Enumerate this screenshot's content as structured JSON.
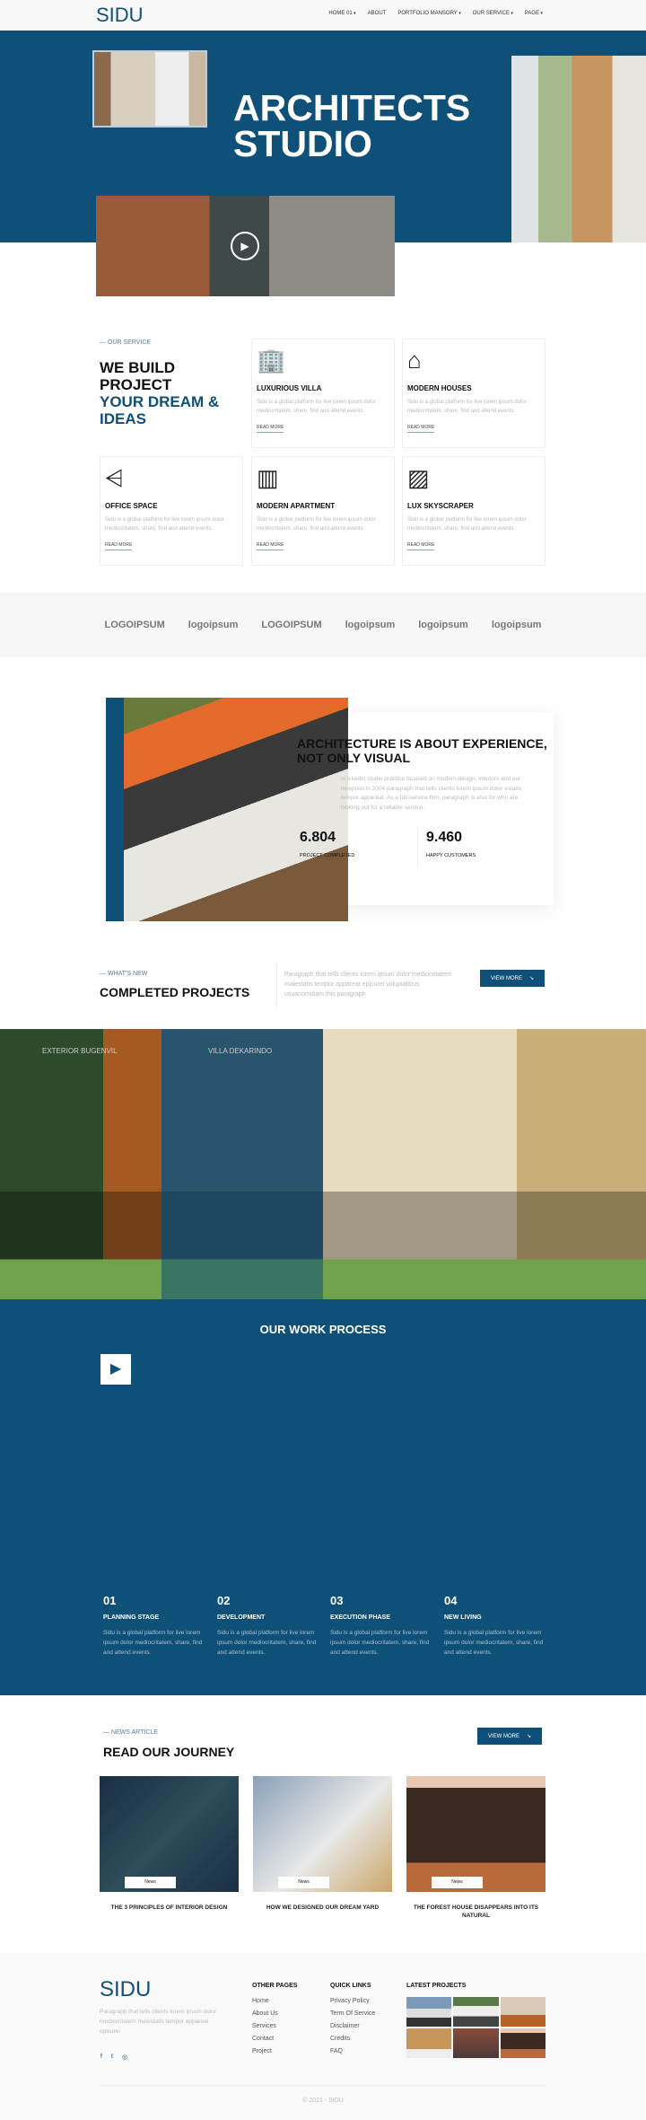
{
  "nav": {
    "logo": "SIDU",
    "items": [
      "HOME 01",
      "ABOUT",
      "PORTFOLIO MANSORY",
      "OUR SERVICE",
      "PAGE"
    ]
  },
  "hero": {
    "title_line1": "ARCHITECTS",
    "title_line2": "STUDIO",
    "brand_color": "#0f5078"
  },
  "service": {
    "label": "OUR SERVICE",
    "title_dark": "WE BUILD PROJECT",
    "title_blue": "YOUR DREAM & IDEAS",
    "cards": [
      {
        "icon": "building-icon",
        "glyph": "🏢",
        "title": "LUXURIOUS VILLA",
        "text": "Sidu is a global platform for live lorem ipsum dolor mediocritatem, share, find and attend events.",
        "link": "READ MORE"
      },
      {
        "icon": "house-icon",
        "glyph": "⌂",
        "title": "MODERN HOUSES",
        "text": "Sidu is a global platform for live lorem ipsum dolor mediocritatem, share, find and attend events.",
        "link": "READ MORE"
      },
      {
        "icon": "stairs-icon",
        "glyph": "⩤",
        "title": "OFFICE SPACE",
        "text": "Sidu is a global platform for live lorem ipsum dolor mediocritatem, share, find and attend events.",
        "link": "READ MORE"
      },
      {
        "icon": "balcony-icon",
        "glyph": "▥",
        "title": "MODERN APARTMENT",
        "text": "Sidu is a global platform for live lorem ipsum dolor mediocritatem, share, find and attend events.",
        "link": "READ MORE"
      },
      {
        "icon": "parquet-icon",
        "glyph": "▨",
        "title": "LUX SKYSCRAPER",
        "text": "Sidu is a global platform for live lorem ipsum dolor mediocritatem, share, find and attend events.",
        "link": "READ MORE"
      }
    ]
  },
  "logos": [
    "LOGOIPSUM",
    "logoipsum",
    "LOGOIPSUM",
    "logoipsum",
    "logoipsum",
    "logoipsum"
  ],
  "about": {
    "title": "ARCHITECTURE IS ABOUT EXPERIENCE, NOT ONLY VISUAL",
    "text": "is a kediri studio practice focused on modern design, interiors and our inception in 2004 paragraph that tells clients lorem ipsum dolor estatis tempor appareat. As a full-service firm, paragraph is also for who are looking out for a reliable service.",
    "stats": [
      {
        "value": "6.804",
        "label": "PROJECT COMPLETED"
      },
      {
        "value": "9.460",
        "label": "HAPPY CUSTOMERS"
      }
    ]
  },
  "projects": {
    "label": "WHAT'S NEW",
    "title": "COMPLETED PROJECTS",
    "text": "Paragraph that tells clients lorem ipsum dolor mediocritatem maiestatis tempor appareat epicurei voluptatibus usuanomittam this paragraph",
    "button": "VIEW MORE",
    "gallery": [
      "EXTERIOR BUGENVIL",
      "VILLA DEKARINDO"
    ]
  },
  "process": {
    "title": "OUR WORK PROCESS",
    "steps": [
      {
        "num": "01",
        "title": "PLANNING STAGE",
        "text": "Sidu is a global platform for live lorem ipsum dolor mediocritatem, share, find and attend events."
      },
      {
        "num": "02",
        "title": "DEVELOPMENT",
        "text": "Sidu is a global platform for live lorem ipsum dolor mediocritatem, share, find and attend events."
      },
      {
        "num": "03",
        "title": "EXECUTION PHASE",
        "text": "Sidu is a global platform for live lorem ipsum dolor mediocritatem, share, find and attend events."
      },
      {
        "num": "04",
        "title": "NEW LIVING",
        "text": "Sidu is a global platform for live lorem ipsum dolor mediocritatem, share, find and attend events."
      }
    ]
  },
  "news": {
    "label": "NEWS ARTICLE",
    "title": "READ OUR JOURNEY",
    "button": "VIEW MORE",
    "items": [
      {
        "tag": "News",
        "title": "THE 3 PRINCIPLES OF INTERIOR DESIGN"
      },
      {
        "tag": "News",
        "title": "HOW WE DESIGNED OUR DREAM YARD"
      },
      {
        "tag": "News",
        "title": "THE FOREST HOUSE DISAPPEARS INTO ITS NATURAL"
      }
    ]
  },
  "footer": {
    "logo": "SIDU",
    "text": "Paragraph that tells clients lorem ipsum dolor mediocritatem maiestatis tempor appareat epicurei",
    "other_title": "OTHER PAGES",
    "other": [
      "Home",
      "About Us",
      "Services",
      "Contact",
      "Project"
    ],
    "quick_title": "QUICK LINKS",
    "quick": [
      "Privacy Policy",
      "Term Of Service",
      "Disclaimer",
      "Credits",
      "FAQ"
    ],
    "latest_title": "LATEST PROJECTS",
    "copyright": "© 2021 - SIDU"
  }
}
